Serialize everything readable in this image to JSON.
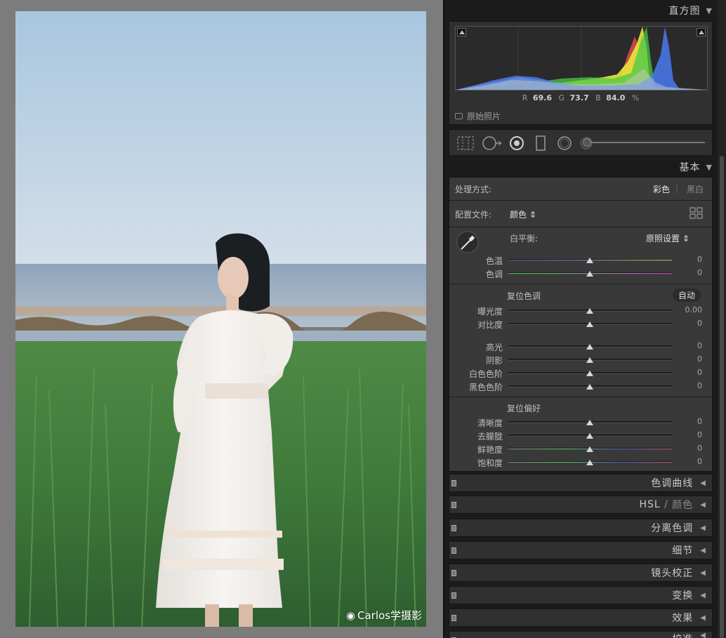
{
  "watermark": "Carlos学摄影",
  "histogram": {
    "title": "直方图",
    "readout": {
      "r_label": "R",
      "r": "69.6",
      "g_label": "G",
      "g": "73.7",
      "b_label": "B",
      "b": "84.0",
      "unit": "%"
    },
    "original_photo": "原始照片"
  },
  "basic": {
    "title": "基本",
    "treatment_label": "处理方式:",
    "treatment_color": "彩色",
    "treatment_bw": "黑白",
    "profile_label": "配置文件:",
    "profile_value": "颜色",
    "wb_label": "白平衡:",
    "wb_value": "原照设置",
    "temp_label": "色温",
    "temp_value": "0",
    "tint_label": "色调",
    "tint_value": "0",
    "tone_reset": "复位色调",
    "auto": "自动",
    "exposure_label": "曝光度",
    "exposure_value": "0.00",
    "contrast_label": "对比度",
    "contrast_value": "0",
    "highlights_label": "高光",
    "highlights_value": "0",
    "shadows_label": "阴影",
    "shadows_value": "0",
    "whites_label": "白色色阶",
    "whites_value": "0",
    "blacks_label": "黑色色阶",
    "blacks_value": "0",
    "presence_reset": "复位偏好",
    "clarity_label": "清晰度",
    "clarity_value": "0",
    "dehaze_label": "去朦胧",
    "dehaze_value": "0",
    "vibrance_label": "鲜艳度",
    "vibrance_value": "0",
    "saturation_label": "饱和度",
    "saturation_value": "0"
  },
  "panels": {
    "tone_curve": "色调曲线",
    "hsl_a": "HSL",
    "hsl_sep": "/",
    "hsl_b": "颜色",
    "split_toning": "分离色调",
    "detail": "细节",
    "lens": "镜头校正",
    "transform": "变换",
    "effects": "效果",
    "calibration": "校准"
  }
}
